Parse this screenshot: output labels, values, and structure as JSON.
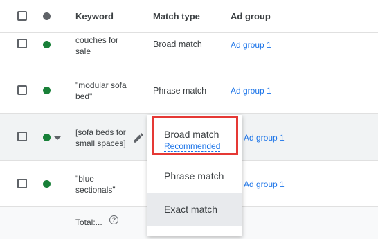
{
  "header": {
    "keyword": "Keyword",
    "match_type": "Match type",
    "ad_group": "Ad group"
  },
  "rows": [
    {
      "keyword": "couches for\nsale",
      "match_type": "Broad match",
      "ad_group": "Ad group 1",
      "status": "green"
    },
    {
      "keyword": "\"modular sofa\nbed\"",
      "match_type": "Phrase match",
      "ad_group": "Ad group 1",
      "status": "green"
    },
    {
      "keyword": "[sofa beds for\nsmall spaces]",
      "match_type": "",
      "ad_group": "Ad group 1",
      "status": "green"
    },
    {
      "keyword": "\"blue\nsectionals\"",
      "match_type": "",
      "ad_group": "Ad group 1",
      "status": "green"
    }
  ],
  "total": {
    "label": "Total:..."
  },
  "dropdown": {
    "options": [
      {
        "label": "Broad match",
        "sublabel": "Recommended"
      },
      {
        "label": "Phrase match"
      },
      {
        "label": "Exact match"
      }
    ]
  },
  "colors": {
    "status_green": "#188038",
    "link_blue": "#1a73e8",
    "highlight_red": "#e53935"
  }
}
